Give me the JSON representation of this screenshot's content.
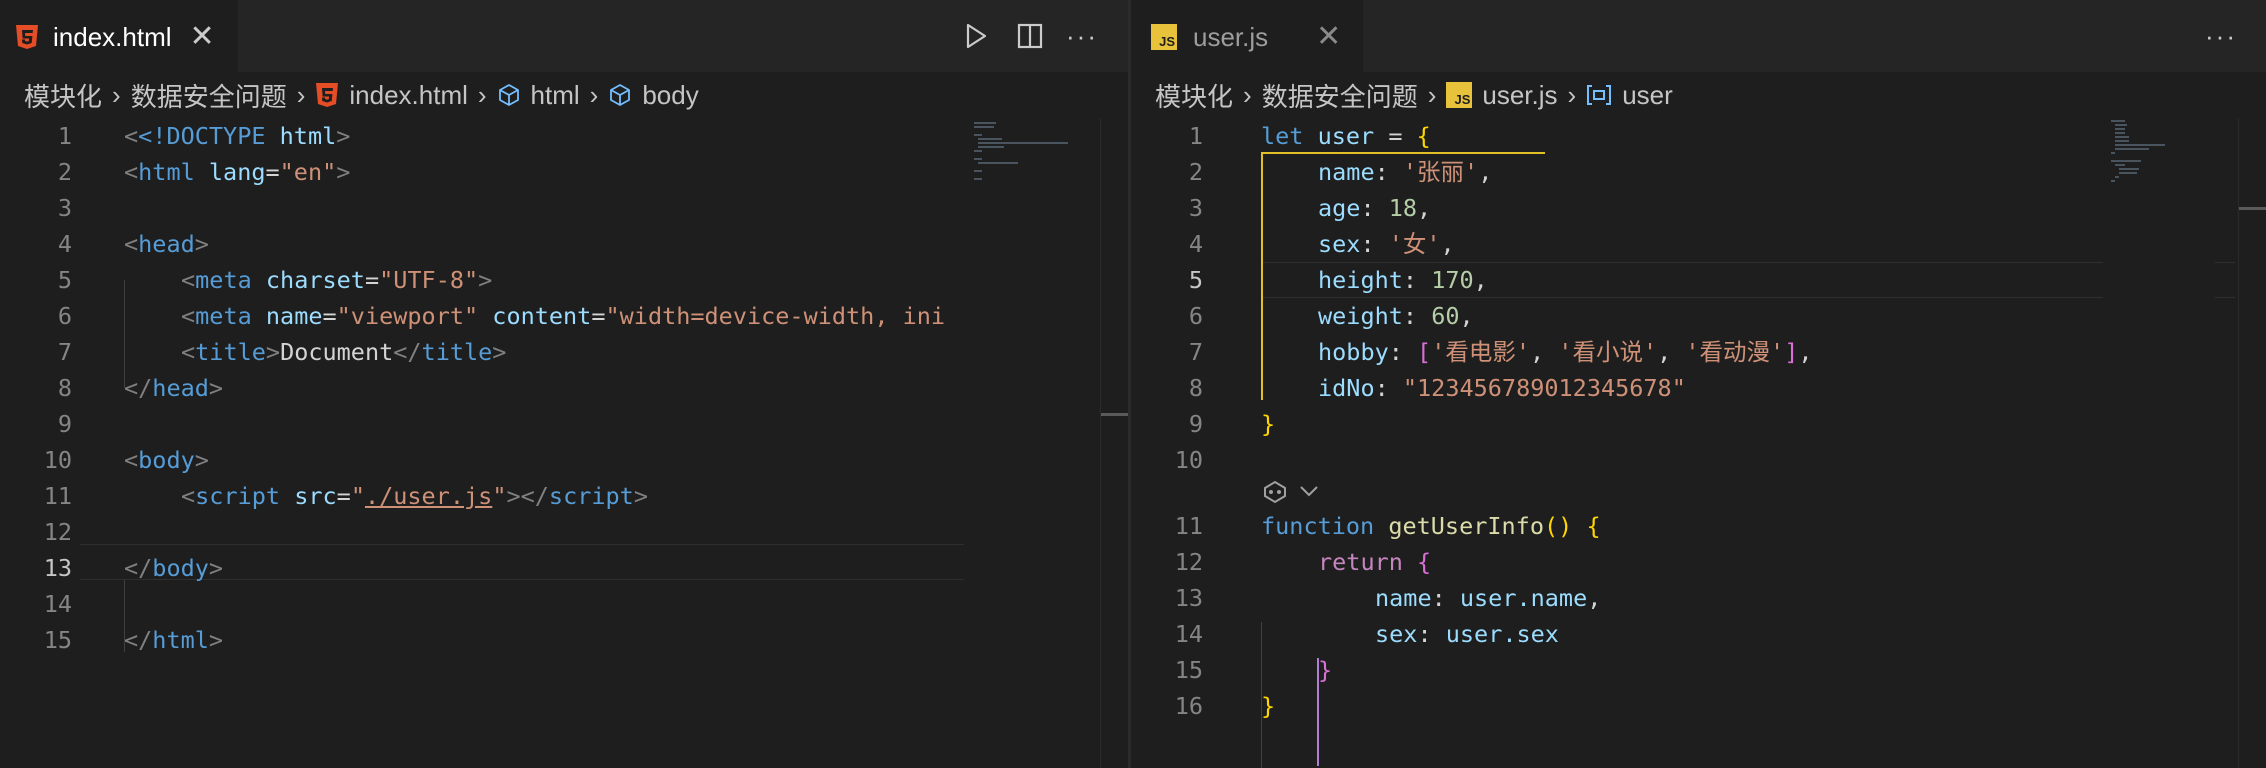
{
  "left": {
    "tab": {
      "label": "index.html",
      "close": "✕",
      "icon": "html5-icon"
    },
    "toolbar": {
      "run_icon": "play-icon",
      "split_icon": "split-editor-icon",
      "more_icon": "ellipsis-icon",
      "more_label": "···"
    },
    "breadcrumb": {
      "folder1": "模块化",
      "folder2": "数据安全问题",
      "file": "index.html",
      "sym1": "html",
      "sym2": "body",
      "sep": "›"
    },
    "lines": {
      "n1": "1",
      "n2": "2",
      "n3": "3",
      "n4": "4",
      "n5": "5",
      "n6": "6",
      "n7": "7",
      "n8": "8",
      "n9": "9",
      "n10": "10",
      "n11": "11",
      "n12": "12",
      "n13": "13",
      "n14": "14",
      "n15": "15",
      "doctype": "<!DOCTYPE",
      "doctype_html": "html",
      "html_tag": "html",
      "lang_attr": "lang",
      "lang_val": "\"en\"",
      "head_tag": "head",
      "meta_tag": "meta",
      "charset_attr": "charset",
      "charset_val": "\"UTF-8\"",
      "name_attr": "name",
      "name_val": "\"viewport\"",
      "content_attr": "content",
      "content_val": "\"width=device-width, ini",
      "title_tag": "title",
      "title_text": "Document",
      "body_tag": "body",
      "script_tag": "script",
      "src_attr": "src",
      "src_val": "./user.js"
    }
  },
  "right": {
    "tab": {
      "label": "user.js",
      "close": "✕",
      "icon": "javascript-file-icon",
      "icon_text": "JS"
    },
    "toolbar": {
      "more_icon": "ellipsis-icon",
      "more_label": "···"
    },
    "breadcrumb": {
      "folder1": "模块化",
      "folder2": "数据安全问题",
      "file": "user.js",
      "sym": "user",
      "sep": "›"
    },
    "lines": {
      "n1": "1",
      "n2": "2",
      "n3": "3",
      "n4": "4",
      "n5": "5",
      "n6": "6",
      "n7": "7",
      "n8": "8",
      "n9": "9",
      "n10": "10",
      "n11": "11",
      "n12": "12",
      "n13": "13",
      "n14": "14",
      "n15": "15",
      "n16": "16",
      "let": "let",
      "user": "user",
      "name": "name",
      "name_val": "'张丽'",
      "age": "age",
      "age_val": "18",
      "sex": "sex",
      "sex_val": "'女'",
      "height": "height",
      "height_val": "170",
      "weight": "weight",
      "weight_val": "60",
      "hobby": "hobby",
      "hobby_1": "'看电影'",
      "hobby_2": "'看小说'",
      "hobby_3": "'看动漫'",
      "idNo": "idNo",
      "idNo_val": "\"123456789012345678\"",
      "function": "function",
      "fn_name": "getUserInfo",
      "return": "return",
      "ret_name": "name",
      "ret_user_name": "user.name",
      "ret_sex": "sex",
      "ret_user_sex": "user.sex",
      "lens_icon": "copilot-icon",
      "lens_chevron": "chevron-down-icon"
    }
  },
  "colors": {
    "html_icon": "#e44d26",
    "js_icon": "#e8c23a",
    "guide_yellow": "#e2c028",
    "guide_purple": "#b07ed2"
  }
}
